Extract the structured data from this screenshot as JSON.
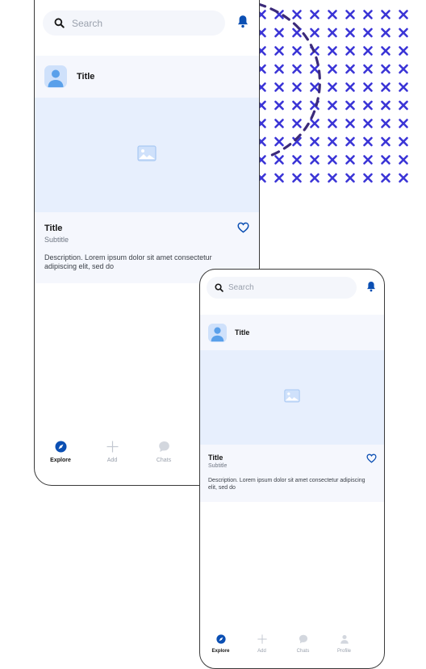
{
  "colors": {
    "accent": "#0B4FB3",
    "card_background": "#F5F7FD",
    "image_placeholder": "#E7EFFD",
    "avatar": "#5AA0EA",
    "decoration_x": "#3A34D6",
    "decoration_dash": "#3B2A7A"
  },
  "screens": [
    {
      "search": {
        "placeholder": "Search",
        "icon": "search-icon"
      },
      "bell_icon": "bell-icon",
      "card": {
        "header_title": "Title",
        "avatar_icon": "user-avatar-icon",
        "image_icon": "image-placeholder-icon",
        "title": "Title",
        "subtitle": "Subtitle",
        "description": "Description. Lorem ipsum dolor sit amet consectetur adipiscing elit, sed do",
        "favorite_icon": "heart-icon"
      },
      "nav": [
        {
          "label": "Explore",
          "icon": "compass-icon",
          "active": true
        },
        {
          "label": "Add",
          "icon": "plus-icon",
          "active": false
        },
        {
          "label": "Chats",
          "icon": "chat-bubble-icon",
          "active": false
        }
      ]
    },
    {
      "search": {
        "placeholder": "Search",
        "icon": "search-icon"
      },
      "bell_icon": "bell-icon",
      "card": {
        "header_title": "Title",
        "avatar_icon": "user-avatar-icon",
        "image_icon": "image-placeholder-icon",
        "title": "Title",
        "subtitle": "Subtitle",
        "description": "Description. Lorem ipsum dolor sit amet consectetur adipiscing elit, sed do",
        "favorite_icon": "heart-icon"
      },
      "nav": [
        {
          "label": "Explore",
          "icon": "compass-icon",
          "active": true
        },
        {
          "label": "Add",
          "icon": "plus-icon",
          "active": false
        },
        {
          "label": "Chats",
          "icon": "chat-bubble-icon",
          "active": false
        },
        {
          "label": "Profile",
          "icon": "profile-icon",
          "active": false
        }
      ]
    }
  ]
}
